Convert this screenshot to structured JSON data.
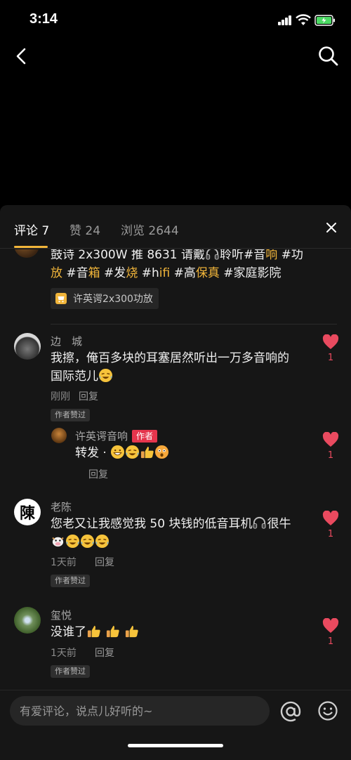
{
  "status": {
    "time": "3:14"
  },
  "tabs": [
    {
      "label": "评论 7"
    },
    {
      "label": "赞 24"
    },
    {
      "label": "浏览 2644"
    }
  ],
  "post": {
    "line1": "鼓诗 2x300W 推 8631 请戴",
    "line1b": "聆听#音",
    "line1c": "响",
    "line1d": " #功",
    "line2a": "放",
    "line2b": " #音",
    "line2c": "箱",
    "line2d": " #发",
    "line2e": "烧",
    "line2f": " #h",
    "line2g": "ifi",
    "line2h": " #高",
    "line2i": "保真",
    "line2j": " #家庭影院",
    "product_tag": "许英谔2x300功放"
  },
  "comments": [
    {
      "name": "边　城",
      "line1": "我擦，俺百多块的耳塞居然听出一万多音响的",
      "line2": "国际范儿",
      "time": "刚刚",
      "reply": "回复",
      "badge": "作者赞过",
      "likes": "1",
      "replies": [
        {
          "name": "许英谔音响",
          "author_badge": "作者",
          "text": "转发 · ",
          "reply": "回复",
          "likes": "1"
        }
      ]
    },
    {
      "name": "老陈",
      "line1a": "您老又让我感觉我 50 块钱的低音耳机",
      "line1b": "很牛",
      "time": "1天前",
      "reply": "回复",
      "badge": "作者赞过",
      "likes": "1",
      "avatar_char": "陳"
    },
    {
      "name": "玺悦",
      "line1": "没谁了",
      "time": "1天前",
      "reply": "回复",
      "badge": "作者赞过",
      "likes": "1"
    }
  ],
  "input": {
    "placeholder": "有爱评论，说点儿好听的~"
  },
  "colors": {
    "accent": "#f1b53a",
    "like": "#e94a5f",
    "author": "#e5354d"
  },
  "icons": [
    "back-icon",
    "search-icon",
    "close-icon",
    "heart-icon",
    "cart-icon",
    "at-icon",
    "smiley-icon",
    "headphones-icon"
  ]
}
